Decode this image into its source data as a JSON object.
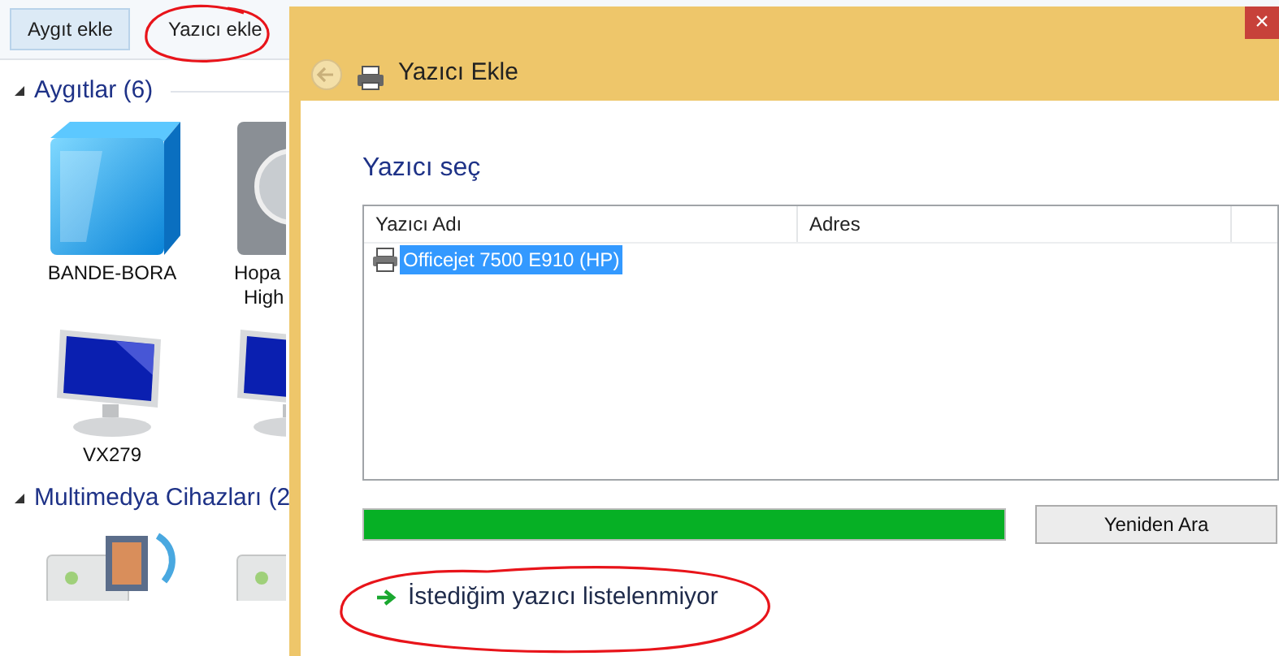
{
  "toolbar": {
    "buttons": [
      {
        "label": "Aygıt ekle",
        "selected": true
      },
      {
        "label": "Yazıcı ekle",
        "selected": false
      }
    ]
  },
  "groups": [
    {
      "title": "Aygıtlar (6)",
      "expanded": true,
      "rows": [
        [
          {
            "kind": "computer",
            "label_lines": [
              "BANDE-BORA"
            ]
          },
          {
            "kind": "speaker",
            "label_lines": [
              "Hopa",
              "High"
            ]
          }
        ],
        [
          {
            "kind": "monitor",
            "label_lines": [
              "VX279"
            ]
          },
          {
            "kind": "monitor"
          }
        ]
      ]
    },
    {
      "title": "Multimedya Cihazları (2",
      "expanded": true,
      "rows": [
        [
          {
            "kind": "media"
          },
          {
            "kind": "media"
          }
        ]
      ]
    }
  ],
  "dialog": {
    "title": "Yazıcı Ekle",
    "close": "×",
    "heading": "Yazıcı seç",
    "table": {
      "columns": [
        "Yazıcı Adı",
        "Adres"
      ],
      "rows": [
        {
          "name": "Officejet 7500 E910 (HP)",
          "selected": true
        }
      ]
    },
    "progress": {
      "level": 1
    },
    "search_again_button": "Yeniden Ara",
    "link": "İstediğim yazıcı listelenmiyor"
  }
}
